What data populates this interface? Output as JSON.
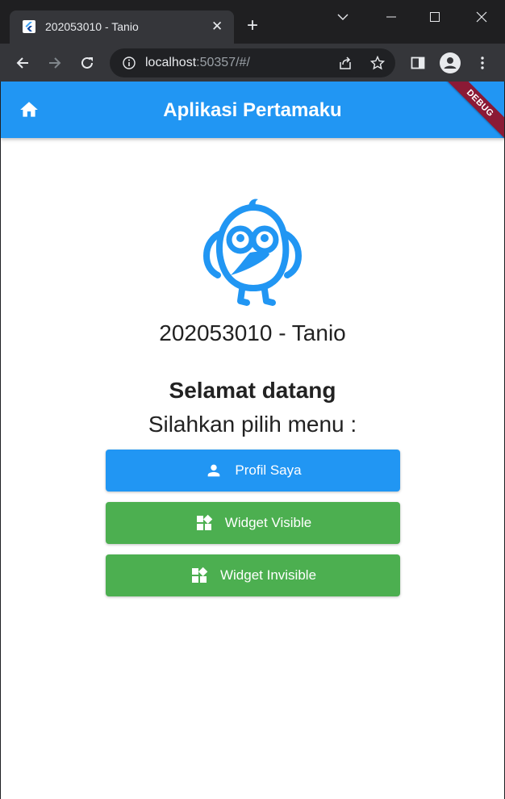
{
  "browser": {
    "tab_title": "202053010 - Tanio",
    "url_host": "localhost",
    "url_rest": ":50357/#/"
  },
  "app": {
    "title": "Aplikasi Pertamaku",
    "debug_label": "DEBUG",
    "user_line": "202053010 - Tanio",
    "welcome": "Selamat datang",
    "subtitle": "Silahkan pilih menu :",
    "buttons": [
      {
        "label": "Profil Saya",
        "icon": "person-icon",
        "color": "#2196f3"
      },
      {
        "label": "Widget Visible",
        "icon": "widgets-icon",
        "color": "#4caf50"
      },
      {
        "label": "Widget Invisible",
        "icon": "widgets-icon",
        "color": "#4caf50"
      }
    ]
  },
  "colors": {
    "appbar": "#2196f3",
    "green": "#4caf50",
    "debug_banner": "#8b1a35"
  }
}
